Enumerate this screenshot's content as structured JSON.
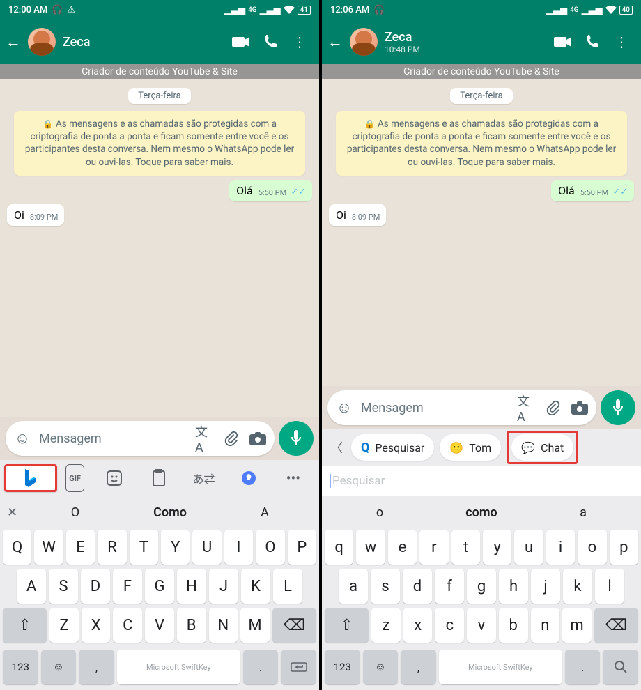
{
  "left": {
    "status": {
      "time": "12:00 AM",
      "battery": "41"
    },
    "contact": {
      "name": "Zeca",
      "sub": ""
    },
    "pinned": "Criador de conteúdo YouTube & Site",
    "day": "Terça-feira",
    "encryption": "As mensagens e as chamadas são protegidas com a criptografia de ponta a ponta e ficam somente entre você e os participantes desta conversa. Nem mesmo o WhatsApp pode ler ou ouvi-las. Toque para saber mais.",
    "msg_out": {
      "text": "Olá",
      "time": "5:50 PM"
    },
    "msg_in": {
      "text": "Oi",
      "time": "8:09 PM"
    },
    "input_placeholder": "Mensagem",
    "suggestions": {
      "a": "O",
      "b": "Como",
      "c": "A"
    },
    "rows": {
      "r1": [
        "Q",
        "W",
        "E",
        "R",
        "T",
        "Y",
        "U",
        "I",
        "O",
        "P"
      ],
      "r2": [
        "A",
        "S",
        "D",
        "F",
        "G",
        "H",
        "J",
        "K",
        "L"
      ],
      "r3": [
        "Z",
        "X",
        "C",
        "V",
        "B",
        "N",
        "M"
      ]
    },
    "num_label": "123",
    "space_label": "Microsoft SwiftKey"
  },
  "right": {
    "status": {
      "time": "12:06 AM",
      "battery": "40"
    },
    "contact": {
      "name": "Zeca",
      "sub": "10:48 PM"
    },
    "pinned": "Criador de conteúdo YouTube & Site",
    "day": "Terça-feira",
    "encryption": "As mensagens e as chamadas são protegidas com a criptografia de ponta a ponta e ficam somente entre você e os participantes desta conversa. Nem mesmo o WhatsApp pode ler ou ouvi-las. Toque para saber mais.",
    "msg_out": {
      "text": "Olá",
      "time": "5:50 PM"
    },
    "msg_in": {
      "text": "Oi",
      "time": "8:09 PM"
    },
    "input_placeholder": "Mensagem",
    "bing": {
      "search": "Pesquisar",
      "tone": "Tom",
      "chat": "Chat"
    },
    "search_placeholder": "Pesquisar",
    "suggestions": {
      "a": "o",
      "b": "como",
      "c": "a"
    },
    "rows": {
      "r1": [
        "q",
        "w",
        "e",
        "r",
        "t",
        "y",
        "u",
        "i",
        "o",
        "p"
      ],
      "r2": [
        "a",
        "s",
        "d",
        "f",
        "g",
        "h",
        "j",
        "k",
        "l"
      ],
      "r3": [
        "z",
        "x",
        "c",
        "v",
        "b",
        "n",
        "m"
      ]
    },
    "num_label": "123",
    "space_label": "Microsoft SwiftKey"
  },
  "network_label": "4G"
}
